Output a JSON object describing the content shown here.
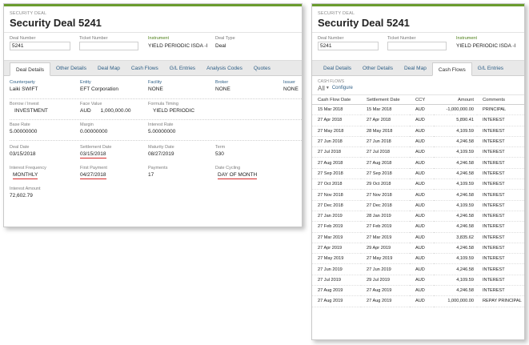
{
  "left": {
    "header": {
      "subtitle": "SECURITY DEAL",
      "title": "Security Deal 5241"
    },
    "fields": {
      "deal_number_label": "Deal Number",
      "deal_number": "5241",
      "ticket_number_label": "Ticket Number",
      "ticket_number": "",
      "instrument_label": "Instrument",
      "instrument": "YIELD PERIODIC ISDA -I",
      "deal_type_label": "Deal Type",
      "deal_type": "Deal"
    },
    "tabs": [
      "Deal Details",
      "Other Details",
      "Deal Map",
      "Cash Flows",
      "G/L Entries",
      "Analysis Codes",
      "Quotes"
    ],
    "details": {
      "counterparty_label": "Counterparty",
      "counterparty": "Laiki SWIFT",
      "entity_label": "Entity",
      "entity": "EFT Corporation",
      "facility_label": "Facility",
      "facility": "NONE",
      "broker_label": "Broker",
      "broker": "NONE",
      "issuer_label": "Issuer",
      "issuer": "NONE",
      "borrow_invest_label": "Borrow / Invest",
      "borrow_invest": "INVESTMENT",
      "face_value_label": "Face Value",
      "face_value_ccy": "AUD",
      "face_value": "1,000,000.00",
      "formula_timing_label": "Formula Timing",
      "formula_timing": "YIELD PERIODIC",
      "base_rate_label": "Base Rate",
      "base_rate": "5.00000000",
      "margin_label": "Margin",
      "margin": "0.00000000",
      "interest_rate_label": "Interest Rate",
      "interest_rate": "5.00000000",
      "deal_date_label": "Deal Date",
      "deal_date": "03/15/2018",
      "settlement_date_label": "Settlement Date",
      "settlement_date": "03/15/2018",
      "maturity_date_label": "Maturity Date",
      "maturity_date": "08/27/2019",
      "term_label": "Term",
      "term": "530",
      "interest_frequency_label": "Interest Frequency",
      "interest_frequency": "MONTHLY",
      "first_payment_label": "First Payment",
      "first_payment": "04/27/2018",
      "payments_label": "Payments",
      "payments": "17",
      "date_cycling_label": "Date Cycling",
      "date_cycling": "DAY OF MONTH",
      "interest_amount_label": "Interest Amount",
      "interest_amount": "72,602.79"
    }
  },
  "right": {
    "header": {
      "subtitle": "SECURITY DEAL",
      "title": "Security Deal 5241"
    },
    "fields": {
      "deal_number_label": "Deal Number",
      "deal_number": "5241",
      "ticket_number_label": "Ticket Number",
      "ticket_number": "",
      "instrument_label": "Instrument",
      "instrument": "YIELD PERIODIC ISDA -I"
    },
    "tabs": [
      "Deal Details",
      "Other Details",
      "Deal Map",
      "Cash Flows",
      "G/L Entries"
    ],
    "cash_flows": {
      "section_title": "CASH FLOWS",
      "filter": "All",
      "configure": "Configure",
      "columns": [
        "Cash Flow Date",
        "Settlement Date",
        "CCY",
        "Amount",
        "Comments"
      ],
      "rows": [
        [
          "15 Mar 2018",
          "15 Mar 2018",
          "AUD",
          "-1,000,000.00",
          "PRINCIPAL"
        ],
        [
          "27 Apr 2018",
          "27 Apr 2018",
          "AUD",
          "5,890.41",
          "INTEREST"
        ],
        [
          "27 May 2018",
          "28 May 2018",
          "AUD",
          "4,109.59",
          "INTEREST"
        ],
        [
          "27 Jun 2018",
          "27 Jun 2018",
          "AUD",
          "4,246.58",
          "INTEREST"
        ],
        [
          "27 Jul 2018",
          "27 Jul 2018",
          "AUD",
          "4,109.59",
          "INTEREST"
        ],
        [
          "27 Aug 2018",
          "27 Aug 2018",
          "AUD",
          "4,246.58",
          "INTEREST"
        ],
        [
          "27 Sep 2018",
          "27 Sep 2018",
          "AUD",
          "4,246.58",
          "INTEREST"
        ],
        [
          "27 Oct 2018",
          "29 Oct 2018",
          "AUD",
          "4,109.59",
          "INTEREST"
        ],
        [
          "27 Nov 2018",
          "27 Nov 2018",
          "AUD",
          "4,246.58",
          "INTEREST"
        ],
        [
          "27 Dec 2018",
          "27 Dec 2018",
          "AUD",
          "4,109.59",
          "INTEREST"
        ],
        [
          "27 Jan 2019",
          "28 Jan 2019",
          "AUD",
          "4,246.58",
          "INTEREST"
        ],
        [
          "27 Feb 2019",
          "27 Feb 2019",
          "AUD",
          "4,246.58",
          "INTEREST"
        ],
        [
          "27 Mar 2019",
          "27 Mar 2019",
          "AUD",
          "3,835.62",
          "INTEREST"
        ],
        [
          "27 Apr 2019",
          "29 Apr 2019",
          "AUD",
          "4,246.58",
          "INTEREST"
        ],
        [
          "27 May 2019",
          "27 May 2019",
          "AUD",
          "4,109.59",
          "INTEREST"
        ],
        [
          "27 Jun 2019",
          "27 Jun 2019",
          "AUD",
          "4,246.58",
          "INTEREST"
        ],
        [
          "27 Jul 2019",
          "29 Jul 2019",
          "AUD",
          "4,109.59",
          "INTEREST"
        ],
        [
          "27 Aug 2019",
          "27 Aug 2019",
          "AUD",
          "4,246.58",
          "INTEREST"
        ],
        [
          "27 Aug 2019",
          "27 Aug 2019",
          "AUD",
          "1,000,000.00",
          "REPAY PRINCIPAL"
        ]
      ]
    }
  },
  "colors": {
    "accent_green": "#6a9c2e",
    "link_blue": "#2e5f86",
    "highlight_red": "#d62b2b"
  }
}
